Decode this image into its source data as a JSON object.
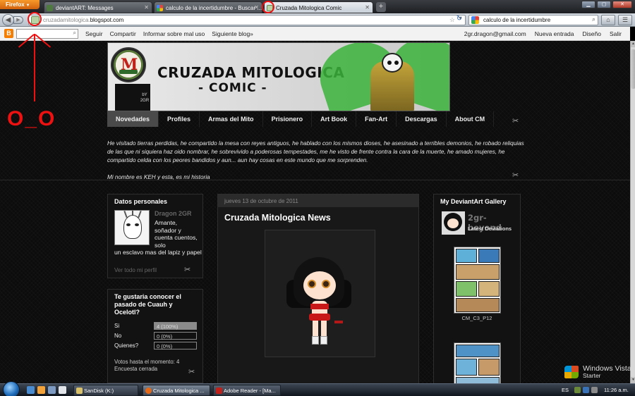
{
  "browser": {
    "app_button": "Firefox",
    "tabs": [
      {
        "label": "deviantART: Messages",
        "active": false
      },
      {
        "label": "calculo de la incertidumbre - Buscar ...",
        "active": false
      },
      {
        "label": "Cruzada Mitologica Comic",
        "active": true
      }
    ],
    "url_prefix": "cruzadamitologica.",
    "url_host": "blogspot.com",
    "search_value": "calculo de la incertidumbre"
  },
  "blogger_bar": {
    "links": [
      "Seguir",
      "Compartir",
      "Informar sobre mal uso",
      "Siguiente blog»"
    ],
    "email": "2gr.dragon@gmail.com",
    "new_post": "Nueva entrada",
    "design": "Diseño",
    "logout": "Salir"
  },
  "header": {
    "title_line1": "CRUZADA MITOLOGICA",
    "title_line2": "- COMIC -",
    "by_text": "bY 2GR"
  },
  "menu": [
    "Novedades",
    "Profiles",
    "Armas del Mito",
    "Prisionero",
    "Art Book",
    "Fan-Art",
    "Descargas",
    "About CM"
  ],
  "intro": {
    "paragraph": "He visitado tierras perdidas, he compartido la mesa con reyes antiguos, he hablado con los mismos dioses, he asesinado a terribles demonios, he robado reliquias de las que ni siquiera haz oido nombrar, he sobrevivido a poderosas tempestades, me he visto de frente contra la cara de la muerte, he amado mujeres, he compartido celda con los peores bandidos y aun... aun hay cosas en este mundo que me sorprenden.",
    "closing": "Mi nombre es KEH y esta, es mi historia"
  },
  "profile": {
    "title": "Datos personales",
    "name": "Dragon 2GR",
    "description_a": "Amante, soñador y cuenta cuentos, solo",
    "description_b": "un esclavo mas del lapiz y papel",
    "link": "Ver todo mi perfil"
  },
  "poll": {
    "question": "Te gustaria conocer el pasado de Cuauh y Ocelotl?",
    "options": [
      {
        "label": "Si",
        "result": "4 (100%)",
        "fraction": 1.0
      },
      {
        "label": "No",
        "result": "0 (0%)",
        "fraction": 0.0
      },
      {
        "label": "Quienes?",
        "result": "0 (0%)",
        "fraction": 0.0
      }
    ],
    "votes": "Votos hasta el momento: 4",
    "status": "Encuesta cerrada"
  },
  "post": {
    "date": "jueves 13 de octubre de 2011",
    "title": "Cruzada Mitologica News"
  },
  "gallery": {
    "title": "My DeviantArt Gallery",
    "username": "2gr-beyond",
    "latest": "Latest Deviations",
    "caption1": "CM_C3_P12"
  },
  "annotation": {
    "text": "O_O"
  },
  "taskbar": {
    "items": [
      {
        "label": "SanDisk (K:)",
        "active": false
      },
      {
        "label": "Cruzada Mitologica ...",
        "active": true
      },
      {
        "label": "Adobe Reader - [Ma...",
        "active": false
      }
    ],
    "lang": "ES",
    "clock": "11:26 a.m."
  },
  "windows_brand": {
    "line1": "Windows Vista",
    "line2": "Starter"
  }
}
